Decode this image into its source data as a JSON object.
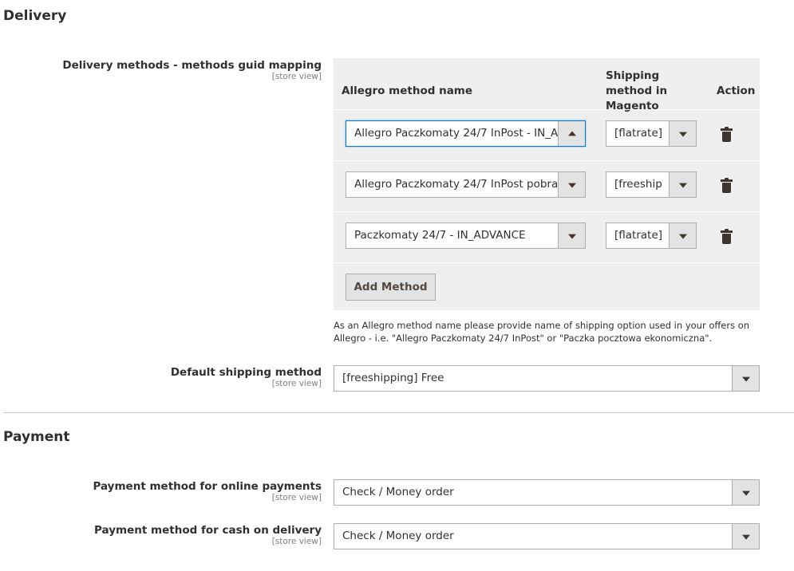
{
  "delivery": {
    "section_title": "Delivery",
    "mapping": {
      "label": "Delivery methods - methods guid mapping",
      "scope": "[store view]",
      "headers": {
        "allegro": "Allegro method name",
        "shipping": "Shipping method in Magento",
        "action": "Action"
      },
      "rows": [
        {
          "allegro": "Allegro Paczkomaty 24/7 InPost - IN_A",
          "shipping": "[flatrate]",
          "open": true
        },
        {
          "allegro": "Allegro Paczkomaty 24/7 InPost pobra",
          "shipping": "[freeship",
          "open": false
        },
        {
          "allegro": "Paczkomaty 24/7 - IN_ADVANCE",
          "shipping": "[flatrate]",
          "open": false
        }
      ],
      "add_button": "Add Method",
      "note": "As an Allegro method name please provide name of shipping option used in your offers on Allegro - i.e. \"Allegro Paczkomaty 24/7 InPost\" or \"Paczka pocztowa ekonomiczna\"."
    },
    "default_shipping": {
      "label": "Default shipping method",
      "scope": "[store view]",
      "value": "[freeshipping] Free"
    }
  },
  "payment": {
    "section_title": "Payment",
    "online": {
      "label": "Payment method for online payments",
      "scope": "[store view]",
      "value": "Check / Money order"
    },
    "cod": {
      "label": "Payment method for cash on delivery",
      "scope": "[store view]",
      "value": "Check / Money order"
    }
  },
  "icons": {
    "trash": "trash-icon",
    "dropdown": "chevron-down-icon"
  }
}
